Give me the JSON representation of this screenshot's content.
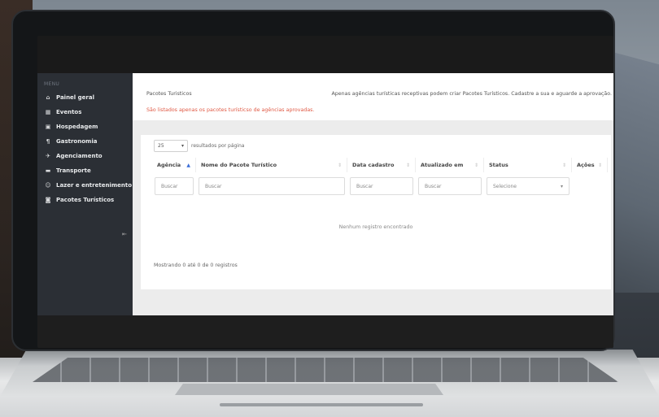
{
  "sidebar": {
    "menu_label": "MENU",
    "items": [
      {
        "label": "Painel geral",
        "icon": "home-icon"
      },
      {
        "label": "Eventos",
        "icon": "calendar-icon"
      },
      {
        "label": "Hospedagem",
        "icon": "bed-icon"
      },
      {
        "label": "Gastronomia",
        "icon": "utensils-icon"
      },
      {
        "label": "Agenciamento",
        "icon": "plane-icon"
      },
      {
        "label": "Transporte",
        "icon": "car-icon"
      },
      {
        "label": "Lazer e entretenimento",
        "icon": "smile-icon"
      },
      {
        "label": "Pacotes Turísticos",
        "icon": "suitcase-icon"
      }
    ]
  },
  "header": {
    "title": "Pacotes Turisticos",
    "note": "Apenas agências turísticas receptivas podem criar Pacotes Turísticos. Cadastre a sua e aguarde a aprovação.",
    "warning": "São listados apenas os pacotes turísticso de agências aprovadas."
  },
  "table": {
    "per_page_value": "25",
    "per_page_label": "resultados por página",
    "columns": [
      {
        "label": "Agência"
      },
      {
        "label": "Nome do Pacote Turístico"
      },
      {
        "label": "Data cadastro"
      },
      {
        "label": "Atualizado em"
      },
      {
        "label": "Status"
      },
      {
        "label": "Ações"
      }
    ],
    "filters": {
      "agencia_placeholder": "Buscar",
      "nome_placeholder": "Buscar",
      "data_placeholder": "Buscar",
      "atualizado_placeholder": "Buscar",
      "status_value": "Selecione"
    },
    "empty_message": "Nenhum registro encontrado",
    "showing": "Mostrando 0 até 0 de 0 registros"
  }
}
